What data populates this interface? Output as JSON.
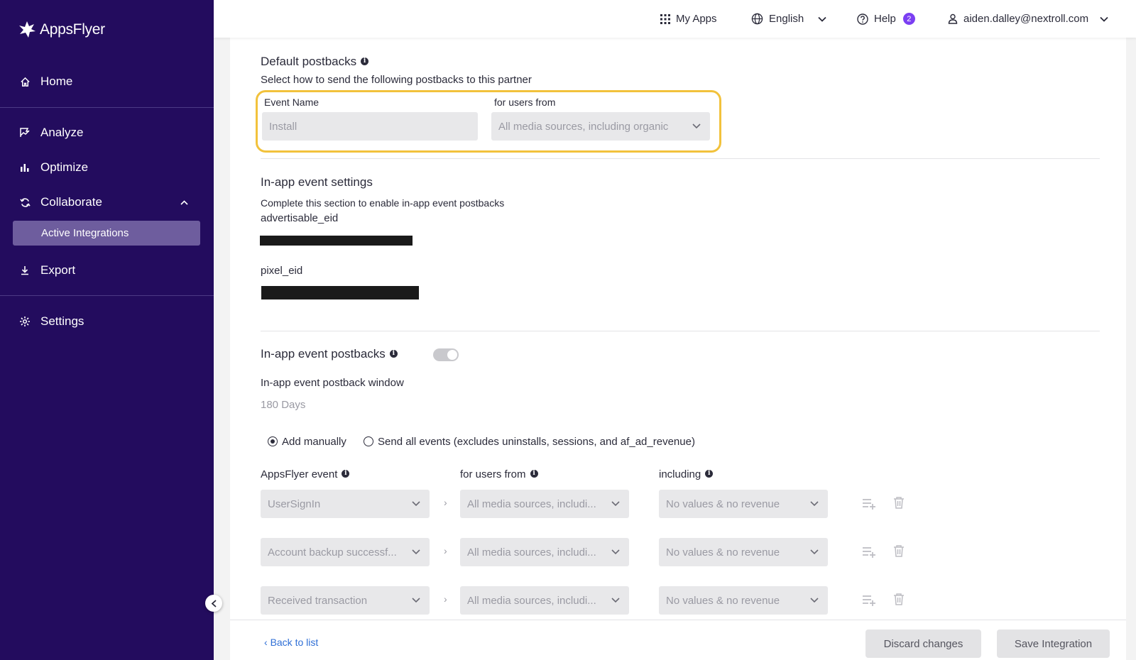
{
  "sidebar": {
    "logo": "AppsFlyer",
    "items": {
      "home": "Home",
      "analyze": "Analyze",
      "optimize": "Optimize",
      "collaborate": "Collaborate",
      "active_integrations": "Active Integrations",
      "export": "Export",
      "settings": "Settings"
    }
  },
  "topbar": {
    "my_apps": "My Apps",
    "language": "English",
    "help": "Help",
    "help_count": "2",
    "user_email": "aiden.dalley@nextroll.com"
  },
  "default_postbacks": {
    "title": "Default postbacks",
    "description": "Select how to send the following postbacks to this partner",
    "event_name_label": "Event Name",
    "event_name_value": "Install",
    "users_from_label": "for users from",
    "users_from_value": "All media sources, including organic"
  },
  "inapp_settings": {
    "title": "In-app event settings",
    "description": "Complete this section to enable in-app event postbacks",
    "field1_label": "advertisable_eid",
    "field2_label": "pixel_eid"
  },
  "inapp_postbacks": {
    "title": "In-app event postbacks",
    "window_label": "In-app event postback window",
    "window_value": "180 Days",
    "radio_manual": "Add manually",
    "radio_all": "Send all events (excludes uninstalls, sessions, and af_ad_revenue)",
    "col_event": "AppsFlyer event",
    "col_users": "for users from",
    "col_including": "including",
    "rows": [
      {
        "event": "UserSignIn",
        "users": "All media sources, includi...",
        "including": "No values & no revenue"
      },
      {
        "event": "Account backup successf...",
        "users": "All media sources, includi...",
        "including": "No values & no revenue"
      },
      {
        "event": "Received transaction",
        "users": "All media sources, includi...",
        "including": "No values & no revenue"
      }
    ]
  },
  "footer": {
    "back": "Back to list",
    "discard": "Discard changes",
    "save": "Save Integration"
  }
}
